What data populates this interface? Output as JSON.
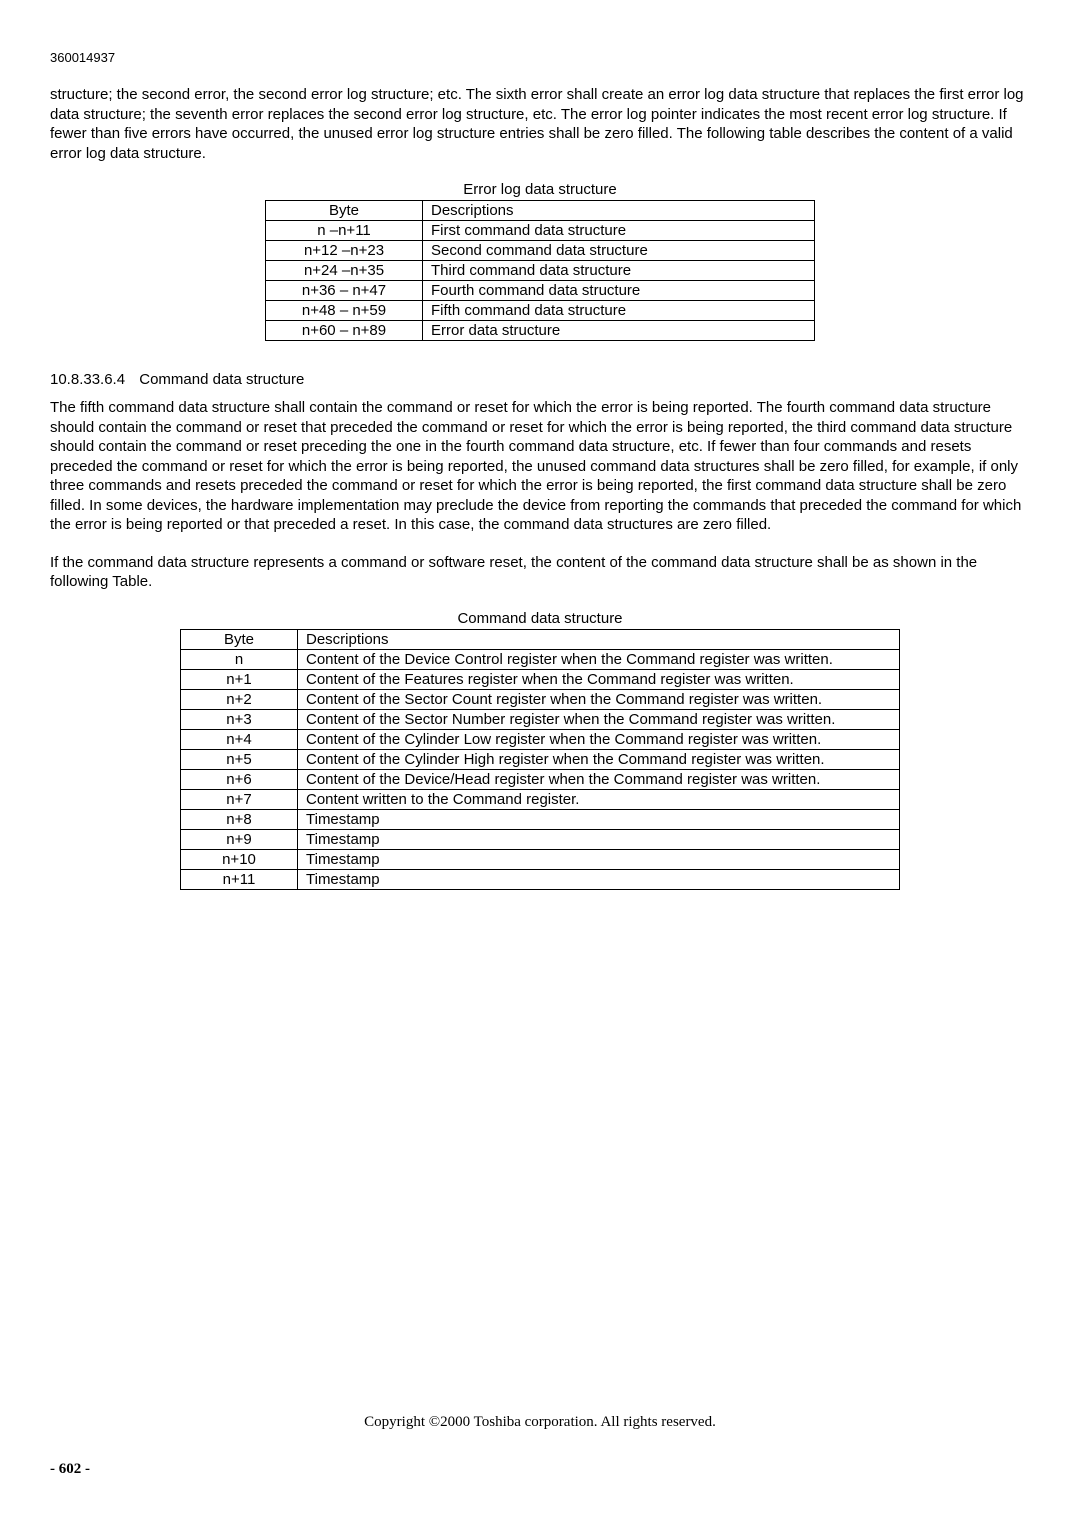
{
  "header_number": "360014937",
  "intro_text": "structure; the second error, the second error log structure; etc. The sixth error shall create an error log data structure that replaces the first error log data structure; the seventh error replaces the second error log structure, etc. The error log pointer indicates the most recent error log structure. If fewer than five errors have occurred, the unused error log structure entries shall be zero filled. The following table describes the content of a valid error log data structure.",
  "table1": {
    "caption": "Error log data structure",
    "headers": {
      "byte": "Byte",
      "desc": "Descriptions"
    },
    "rows": [
      {
        "byte": "n –n+11",
        "desc": "First command data structure"
      },
      {
        "byte": "n+12 –n+23",
        "desc": "Second command data structure"
      },
      {
        "byte": "n+24 –n+35",
        "desc": "Third command data structure"
      },
      {
        "byte": "n+36 – n+47",
        "desc": "Fourth command data structure"
      },
      {
        "byte": "n+48 – n+59",
        "desc": "Fifth command data structure"
      },
      {
        "byte": "n+60 – n+89",
        "desc": "Error data structure"
      }
    ]
  },
  "section": {
    "number": "10.8.33.6.4",
    "title": "Command data structure"
  },
  "para1": "The fifth command data structure shall contain the command or reset for which the error is being reported. The fourth command data structure should contain the command or reset that preceded the command or reset for which the error is being reported, the third command data structure should contain the command or reset preceding the one in the fourth command data structure, etc. If fewer than four commands and resets preceded the command or reset for which the error is being reported, the unused command data structures shall be zero filled, for example, if only three commands and resets preceded the command or reset for which the error is being reported, the first command data structure shall be zero filled. In some devices, the hardware implementation may preclude the device from reporting the commands that preceded the command for which the error is being reported or that preceded a reset. In this case, the command data structures are zero filled.",
  "para2": "If the command data structure represents a command or software reset, the content of the command data structure shall be as shown in the following Table.",
  "table2": {
    "caption": "Command data structure",
    "headers": {
      "byte": "Byte",
      "desc": "Descriptions"
    },
    "rows": [
      {
        "byte": "n",
        "desc": "Content of the Device Control register when the Command register was written."
      },
      {
        "byte": "n+1",
        "desc": "Content of the Features register when the Command register was written."
      },
      {
        "byte": "n+2",
        "desc": "Content of the Sector Count register when the Command register was written."
      },
      {
        "byte": "n+3",
        "desc": "Content of the Sector Number register when the Command register was written."
      },
      {
        "byte": "n+4",
        "desc": "Content of the Cylinder Low register when the Command register was written."
      },
      {
        "byte": "n+5",
        "desc": "Content of the Cylinder High register when the Command register was written."
      },
      {
        "byte": "n+6",
        "desc": "Content of the Device/Head register when the Command register was written."
      },
      {
        "byte": "n+7",
        "desc": "Content written to the Command register."
      },
      {
        "byte": "n+8",
        "desc": "Timestamp"
      },
      {
        "byte": "n+9",
        "desc": "Timestamp"
      },
      {
        "byte": "n+10",
        "desc": "Timestamp"
      },
      {
        "byte": "n+11",
        "desc": "Timestamp"
      }
    ]
  },
  "copyright": "Copyright ©2000 Toshiba corporation. All rights reserved.",
  "page_number": "- 602 -"
}
